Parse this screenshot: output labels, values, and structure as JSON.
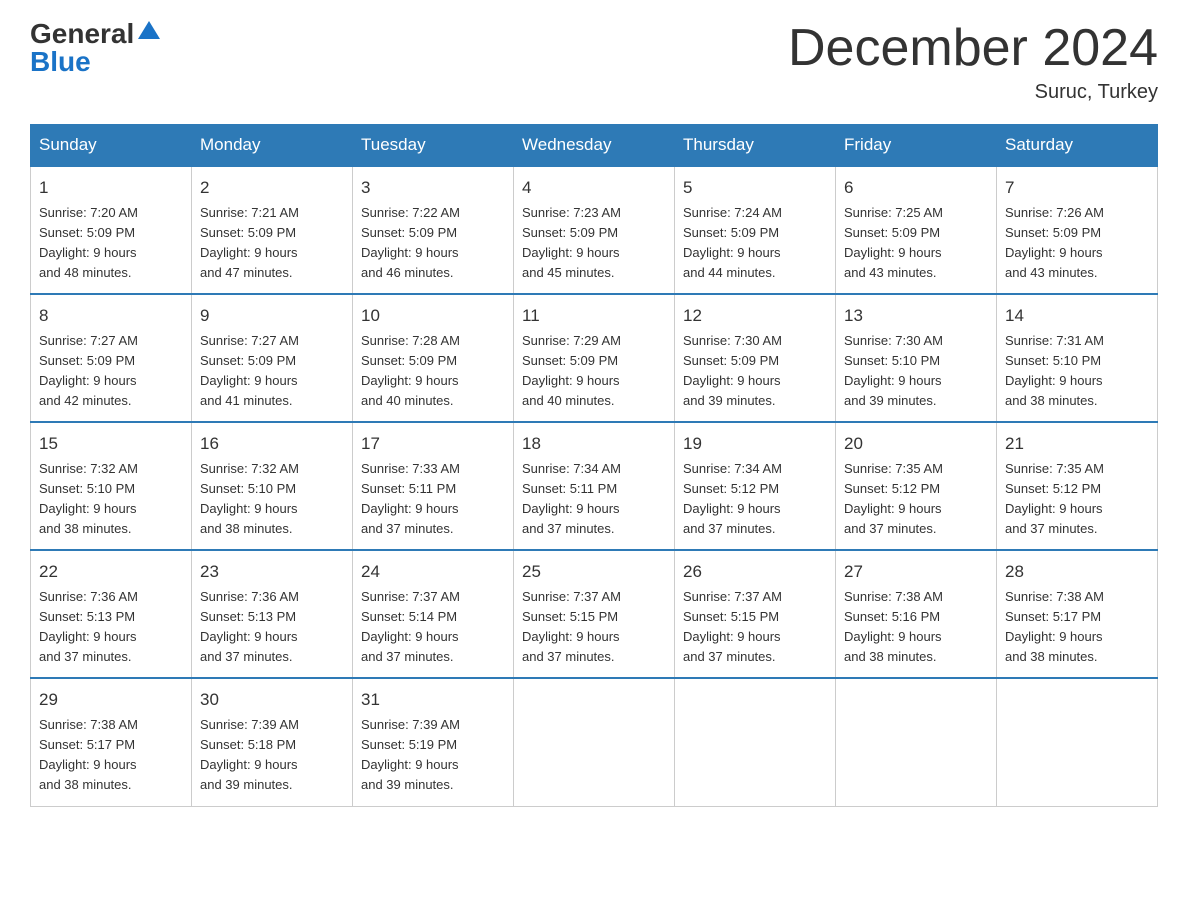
{
  "logo": {
    "general": "General",
    "blue": "Blue"
  },
  "title": "December 2024",
  "subtitle": "Suruc, Turkey",
  "days_header": [
    "Sunday",
    "Monday",
    "Tuesday",
    "Wednesday",
    "Thursday",
    "Friday",
    "Saturday"
  ],
  "weeks": [
    [
      {
        "day": "1",
        "sunrise": "7:20 AM",
        "sunset": "5:09 PM",
        "daylight": "9 hours and 48 minutes."
      },
      {
        "day": "2",
        "sunrise": "7:21 AM",
        "sunset": "5:09 PM",
        "daylight": "9 hours and 47 minutes."
      },
      {
        "day": "3",
        "sunrise": "7:22 AM",
        "sunset": "5:09 PM",
        "daylight": "9 hours and 46 minutes."
      },
      {
        "day": "4",
        "sunrise": "7:23 AM",
        "sunset": "5:09 PM",
        "daylight": "9 hours and 45 minutes."
      },
      {
        "day": "5",
        "sunrise": "7:24 AM",
        "sunset": "5:09 PM",
        "daylight": "9 hours and 44 minutes."
      },
      {
        "day": "6",
        "sunrise": "7:25 AM",
        "sunset": "5:09 PM",
        "daylight": "9 hours and 43 minutes."
      },
      {
        "day": "7",
        "sunrise": "7:26 AM",
        "sunset": "5:09 PM",
        "daylight": "9 hours and 43 minutes."
      }
    ],
    [
      {
        "day": "8",
        "sunrise": "7:27 AM",
        "sunset": "5:09 PM",
        "daylight": "9 hours and 42 minutes."
      },
      {
        "day": "9",
        "sunrise": "7:27 AM",
        "sunset": "5:09 PM",
        "daylight": "9 hours and 41 minutes."
      },
      {
        "day": "10",
        "sunrise": "7:28 AM",
        "sunset": "5:09 PM",
        "daylight": "9 hours and 40 minutes."
      },
      {
        "day": "11",
        "sunrise": "7:29 AM",
        "sunset": "5:09 PM",
        "daylight": "9 hours and 40 minutes."
      },
      {
        "day": "12",
        "sunrise": "7:30 AM",
        "sunset": "5:09 PM",
        "daylight": "9 hours and 39 minutes."
      },
      {
        "day": "13",
        "sunrise": "7:30 AM",
        "sunset": "5:10 PM",
        "daylight": "9 hours and 39 minutes."
      },
      {
        "day": "14",
        "sunrise": "7:31 AM",
        "sunset": "5:10 PM",
        "daylight": "9 hours and 38 minutes."
      }
    ],
    [
      {
        "day": "15",
        "sunrise": "7:32 AM",
        "sunset": "5:10 PM",
        "daylight": "9 hours and 38 minutes."
      },
      {
        "day": "16",
        "sunrise": "7:32 AM",
        "sunset": "5:10 PM",
        "daylight": "9 hours and 38 minutes."
      },
      {
        "day": "17",
        "sunrise": "7:33 AM",
        "sunset": "5:11 PM",
        "daylight": "9 hours and 37 minutes."
      },
      {
        "day": "18",
        "sunrise": "7:34 AM",
        "sunset": "5:11 PM",
        "daylight": "9 hours and 37 minutes."
      },
      {
        "day": "19",
        "sunrise": "7:34 AM",
        "sunset": "5:12 PM",
        "daylight": "9 hours and 37 minutes."
      },
      {
        "day": "20",
        "sunrise": "7:35 AM",
        "sunset": "5:12 PM",
        "daylight": "9 hours and 37 minutes."
      },
      {
        "day": "21",
        "sunrise": "7:35 AM",
        "sunset": "5:12 PM",
        "daylight": "9 hours and 37 minutes."
      }
    ],
    [
      {
        "day": "22",
        "sunrise": "7:36 AM",
        "sunset": "5:13 PM",
        "daylight": "9 hours and 37 minutes."
      },
      {
        "day": "23",
        "sunrise": "7:36 AM",
        "sunset": "5:13 PM",
        "daylight": "9 hours and 37 minutes."
      },
      {
        "day": "24",
        "sunrise": "7:37 AM",
        "sunset": "5:14 PM",
        "daylight": "9 hours and 37 minutes."
      },
      {
        "day": "25",
        "sunrise": "7:37 AM",
        "sunset": "5:15 PM",
        "daylight": "9 hours and 37 minutes."
      },
      {
        "day": "26",
        "sunrise": "7:37 AM",
        "sunset": "5:15 PM",
        "daylight": "9 hours and 37 minutes."
      },
      {
        "day": "27",
        "sunrise": "7:38 AM",
        "sunset": "5:16 PM",
        "daylight": "9 hours and 38 minutes."
      },
      {
        "day": "28",
        "sunrise": "7:38 AM",
        "sunset": "5:17 PM",
        "daylight": "9 hours and 38 minutes."
      }
    ],
    [
      {
        "day": "29",
        "sunrise": "7:38 AM",
        "sunset": "5:17 PM",
        "daylight": "9 hours and 38 minutes."
      },
      {
        "day": "30",
        "sunrise": "7:39 AM",
        "sunset": "5:18 PM",
        "daylight": "9 hours and 39 minutes."
      },
      {
        "day": "31",
        "sunrise": "7:39 AM",
        "sunset": "5:19 PM",
        "daylight": "9 hours and 39 minutes."
      },
      null,
      null,
      null,
      null
    ]
  ]
}
